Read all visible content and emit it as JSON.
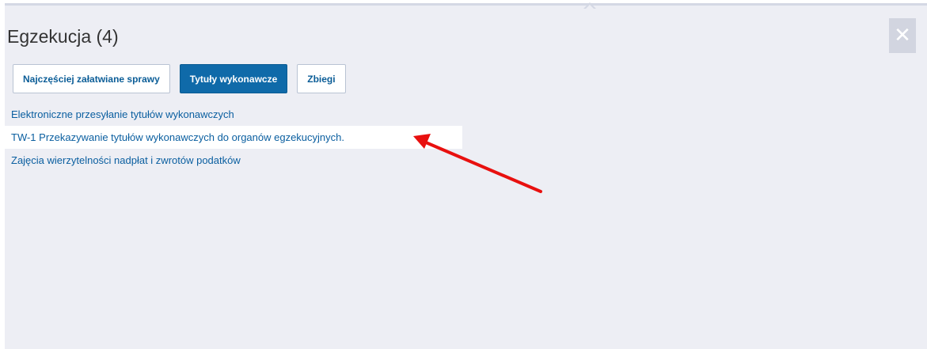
{
  "dialog": {
    "title": "Egzekucja (4)",
    "close_icon": "close-icon"
  },
  "tabs": [
    {
      "label": "Najczęściej załatwiane sprawy",
      "active": false
    },
    {
      "label": "Tytuły wykonawcze",
      "active": true
    },
    {
      "label": "Zbiegi",
      "active": false
    }
  ],
  "links": [
    {
      "label": "Elektroniczne przesyłanie tytułów wykonawczych"
    },
    {
      "label": "TW-1 Przekazywanie tytułów wykonawczych do organów egzekucyjnych."
    },
    {
      "label": "Zajęcia wierzytelności nadpłat i zwrotów podatków"
    }
  ],
  "annotation": {
    "type": "arrow",
    "color": "#e8100f"
  },
  "colors": {
    "accent": "#0f6aa9",
    "link": "#0b5fa0",
    "panel_bg": "#edeef4"
  }
}
